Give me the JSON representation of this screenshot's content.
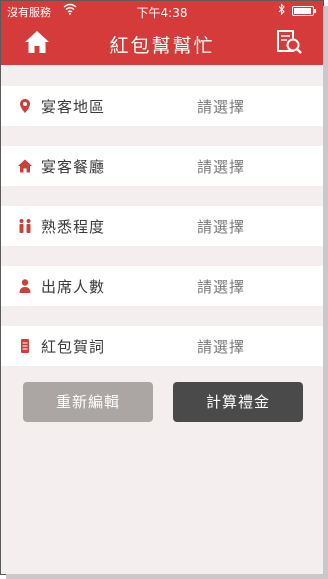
{
  "status_bar": {
    "carrier": "沒有服務",
    "time": "下午4:38"
  },
  "nav": {
    "title": "紅包幫幫忙",
    "home_icon": "home-icon",
    "search_icon": "document-search-icon"
  },
  "form": {
    "rows": [
      {
        "label": "宴客地區",
        "value": "請選擇",
        "icon": "location-pin-icon"
      },
      {
        "label": "宴客餐廳",
        "value": "請選擇",
        "icon": "home-icon"
      },
      {
        "label": "熟悉程度",
        "value": "請選擇",
        "icon": "people-icon"
      },
      {
        "label": "出席人數",
        "value": "請選擇",
        "icon": "person-icon"
      },
      {
        "label": "紅包賀詞",
        "value": "請選擇",
        "icon": "red-envelope-icon"
      }
    ]
  },
  "actions": {
    "reset_label": "重新編輯",
    "calculate_label": "計算禮金"
  },
  "colors": {
    "brand_red": "#d43b3a",
    "background": "#f4efee",
    "reset_button": "#aba6a3",
    "calculate_button": "#4a4a4a"
  }
}
